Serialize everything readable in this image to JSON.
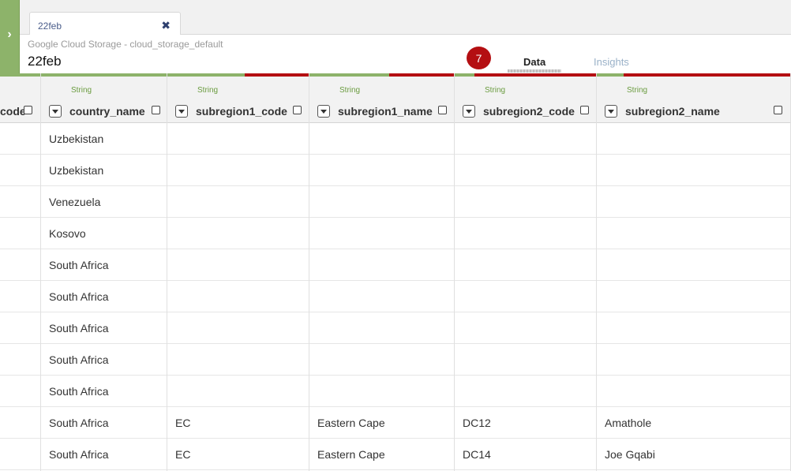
{
  "tab": {
    "label": "22feb",
    "close_icon": "close-icon"
  },
  "header": {
    "subtitle": "Google Cloud Storage - cloud_storage_default",
    "title": "22feb"
  },
  "badge": {
    "count": "7"
  },
  "view_tabs": {
    "data": "Data",
    "insights": "Insights"
  },
  "sidebar": {
    "toggle_icon": "chevron-right-icon"
  },
  "colors": {
    "good": "#8db36a",
    "bad": "#b40f12",
    "type_text": "#6b9c40"
  },
  "columns": [
    {
      "name": "code",
      "type": "",
      "good_fraction": 1.0
    },
    {
      "name": "country_name",
      "type": "String",
      "good_fraction": 1.0
    },
    {
      "name": "subregion1_code",
      "type": "String",
      "good_fraction": 0.55
    },
    {
      "name": "subregion1_name",
      "type": "String",
      "good_fraction": 0.55
    },
    {
      "name": "subregion2_code",
      "type": "String",
      "good_fraction": 0.14
    },
    {
      "name": "subregion2_name",
      "type": "String",
      "good_fraction": 0.14
    }
  ],
  "rows": [
    [
      "",
      "Uzbekistan",
      "",
      "",
      "",
      ""
    ],
    [
      "",
      "Uzbekistan",
      "",
      "",
      "",
      ""
    ],
    [
      "",
      "Venezuela",
      "",
      "",
      "",
      ""
    ],
    [
      "",
      "Kosovo",
      "",
      "",
      "",
      ""
    ],
    [
      "",
      "South Africa",
      "",
      "",
      "",
      ""
    ],
    [
      "",
      "South Africa",
      "",
      "",
      "",
      ""
    ],
    [
      "",
      "South Africa",
      "",
      "",
      "",
      ""
    ],
    [
      "",
      "South Africa",
      "",
      "",
      "",
      ""
    ],
    [
      "",
      "South Africa",
      "",
      "",
      "",
      ""
    ],
    [
      "",
      "South Africa",
      "EC",
      "Eastern Cape",
      "DC12",
      "Amathole"
    ],
    [
      "",
      "South Africa",
      "EC",
      "Eastern Cape",
      "DC14",
      "Joe Gqabi"
    ]
  ]
}
